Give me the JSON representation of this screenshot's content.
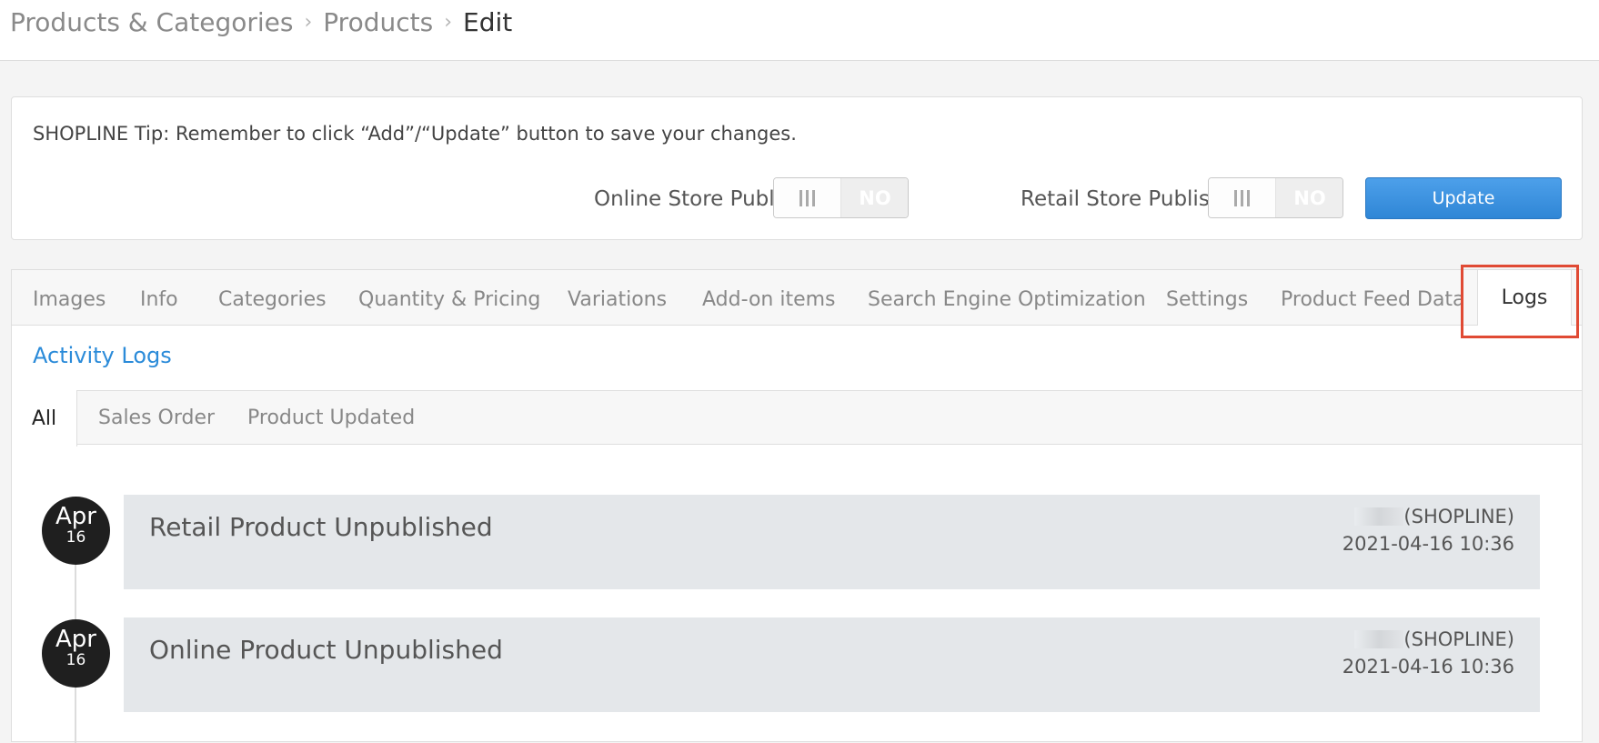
{
  "breadcrumb": {
    "item1": "Products & Categories",
    "sep1": "›",
    "item2": "Products",
    "sep2": "›",
    "current": "Edit"
  },
  "tip": {
    "text": "SHOPLINE Tip: Remember to click “Add”/“Update” button to save your changes."
  },
  "publish": {
    "online_label": "Online Store Publish",
    "online_state": "NO",
    "retail_label": "Retail Store Publish",
    "retail_state": "NO",
    "update_label": "Update"
  },
  "tabs": {
    "images": "Images",
    "info": "Info",
    "categories": "Categories",
    "quantity_pricing": "Quantity & Pricing",
    "variations": "Variations",
    "addon_items": "Add-on items",
    "seo": "Search Engine Optimization",
    "settings": "Settings",
    "product_feed": "Product Feed Data",
    "logs": "Logs"
  },
  "activity": {
    "title": "Activity Logs",
    "subtabs": {
      "all": "All",
      "sales_order": "Sales Order",
      "product_updated": "Product Updated"
    }
  },
  "logs": [
    {
      "month": "Apr",
      "day": "16",
      "title": "Retail Product Unpublished",
      "actor_suffix": "(SHOPLINE)",
      "timestamp": "2021-04-16 10:36"
    },
    {
      "month": "Apr",
      "day": "16",
      "title": "Online Product Unpublished",
      "actor_suffix": "(SHOPLINE)",
      "timestamp": "2021-04-16 10:36"
    }
  ],
  "colors": {
    "accent": "#2b8bd9",
    "update_button": "#3d93e0",
    "highlight": "#e04a34",
    "badge": "#1f1f1f"
  }
}
